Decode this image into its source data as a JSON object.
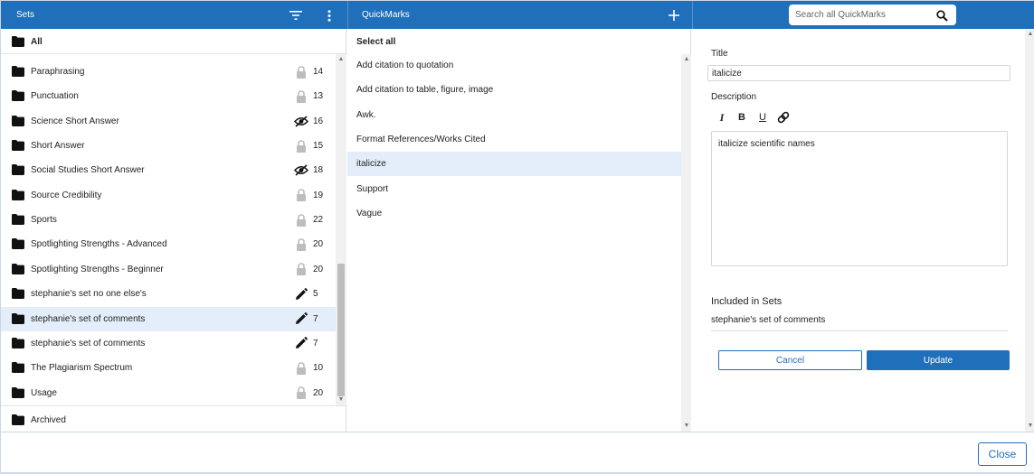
{
  "colors": {
    "brand": "#1f6fbb",
    "selected_row": "#e3eefa"
  },
  "header": {
    "sets_title": "Sets",
    "quickmarks_title": "QuickMarks",
    "search_placeholder": "Search all QuickMarks"
  },
  "sets": {
    "all_label": "All",
    "items": [
      {
        "label": "Paraphrasing",
        "status": "lock-icon",
        "count": "14"
      },
      {
        "label": "Punctuation",
        "status": "lock-icon",
        "count": "13"
      },
      {
        "label": "Science Short Answer",
        "status": "eye-off-icon",
        "count": "16"
      },
      {
        "label": "Short Answer",
        "status": "lock-icon",
        "count": "15"
      },
      {
        "label": "Social Studies Short Answer",
        "status": "eye-off-icon",
        "count": "18"
      },
      {
        "label": "Source Credibility",
        "status": "lock-icon",
        "count": "19"
      },
      {
        "label": "Sports",
        "status": "lock-icon",
        "count": "22"
      },
      {
        "label": "Spotlighting Strengths - Advanced",
        "status": "lock-icon",
        "count": "20"
      },
      {
        "label": "Spotlighting Strengths - Beginner",
        "status": "lock-icon",
        "count": "20"
      },
      {
        "label": "stephanie's set no one else's",
        "status": "pencil-icon",
        "count": "5"
      },
      {
        "label": "stephanie's set of comments",
        "status": "pencil-icon",
        "count": "7",
        "selected": true
      },
      {
        "label": "stephanie's set of comments",
        "status": "pencil-icon",
        "count": "7"
      },
      {
        "label": "The Plagiarism Spectrum",
        "status": "lock-icon",
        "count": "10"
      },
      {
        "label": "Usage",
        "status": "lock-icon",
        "count": "20"
      }
    ],
    "archived_label": "Archived"
  },
  "quickmarks": {
    "select_all_label": "Select all",
    "items": [
      {
        "label": "Add citation to quotation"
      },
      {
        "label": "Add citation to table, figure, image"
      },
      {
        "label": "Awk."
      },
      {
        "label": "Format References/Works Cited"
      },
      {
        "label": "italicize",
        "selected": true
      },
      {
        "label": "Support"
      },
      {
        "label": "Vague"
      }
    ]
  },
  "detail": {
    "title_label": "Title",
    "title_value": "italicize",
    "description_label": "Description",
    "toolbar": {
      "italic": "I",
      "bold": "B",
      "underline": "U"
    },
    "description_text": "italicize scientific names",
    "included_label": "Included in Sets",
    "included_value": "stephanie's set of comments",
    "cancel_label": "Cancel",
    "update_label": "Update"
  },
  "footer": {
    "close_label": "Close"
  }
}
